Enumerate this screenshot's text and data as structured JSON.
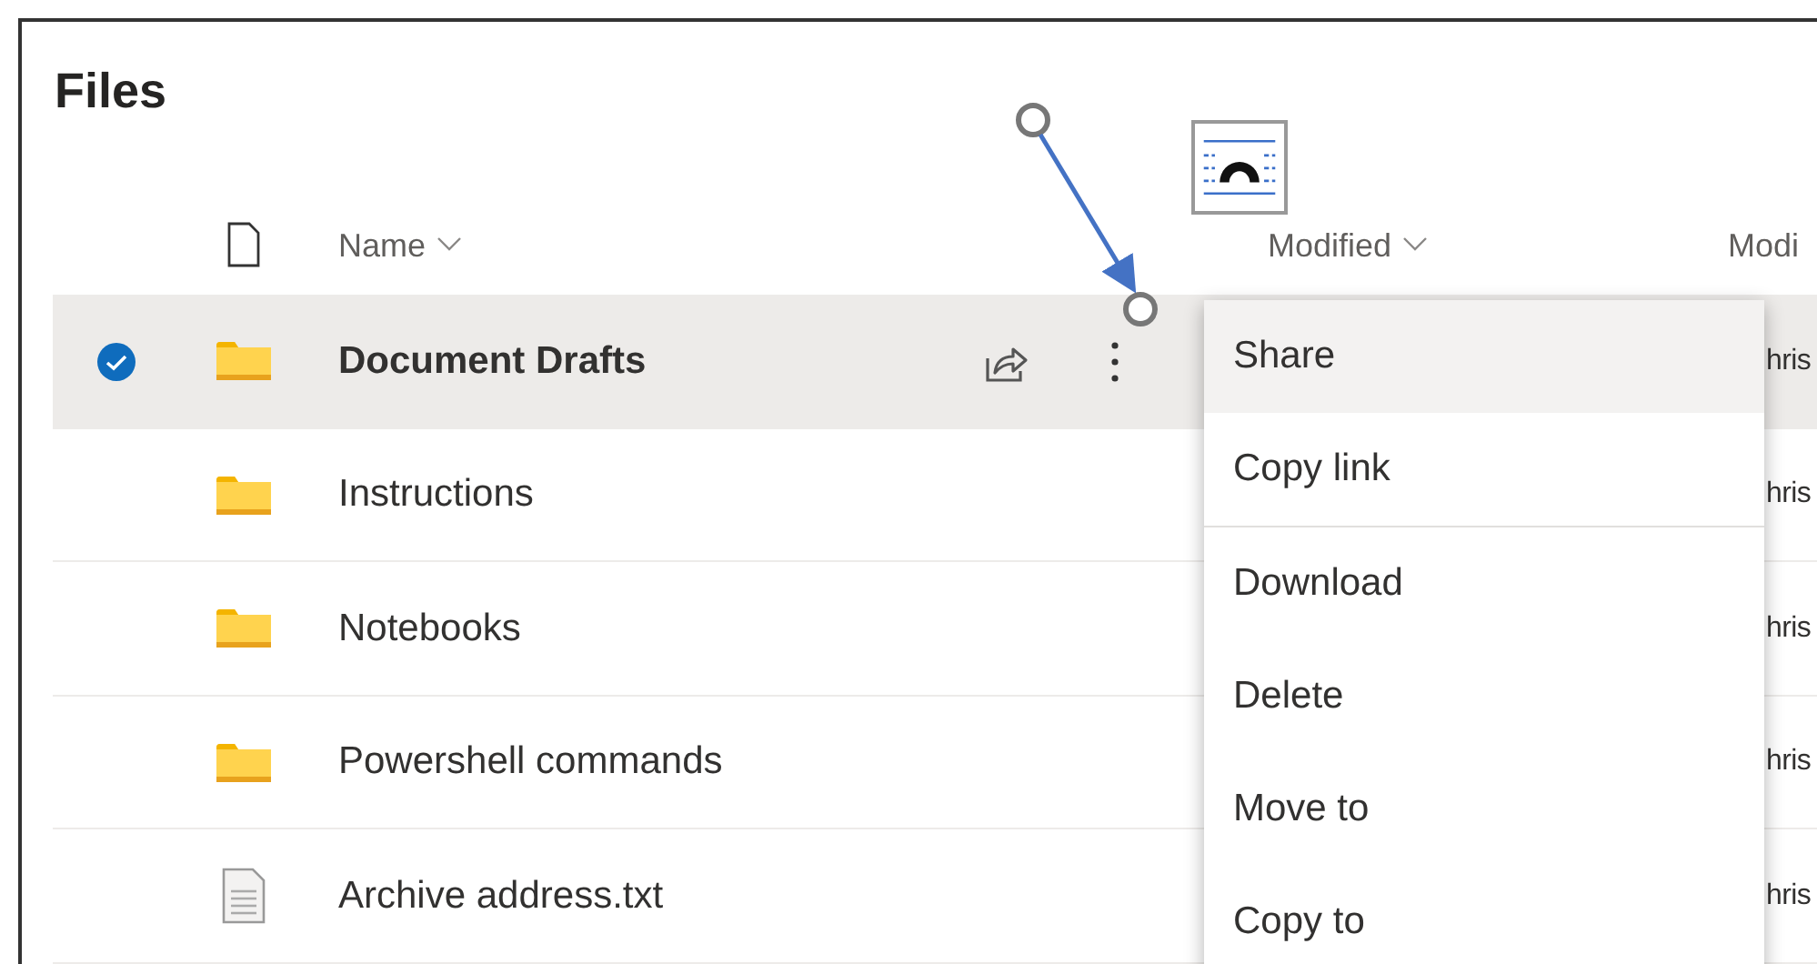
{
  "title": "Files",
  "columns": [
    {
      "label": "Name",
      "sortable": true
    },
    {
      "label": "Modified",
      "sortable": true
    },
    {
      "label": "Modi",
      "sortable": false
    }
  ],
  "rows": [
    {
      "name": "Document Drafts",
      "kind": "folder",
      "selected": true,
      "modified_by": "hris"
    },
    {
      "name": "Instructions",
      "kind": "folder",
      "selected": false,
      "modified_by": "hris"
    },
    {
      "name": "Notebooks",
      "kind": "folder",
      "selected": false,
      "modified_by": "hris"
    },
    {
      "name": "Powershell commands",
      "kind": "folder",
      "selected": false,
      "modified_by": "hris"
    },
    {
      "name": "Archive address.txt",
      "kind": "file",
      "selected": false,
      "modified_by": "hris"
    }
  ],
  "context_menu": [
    {
      "label": "Share",
      "highlighted": true,
      "separator_after": false
    },
    {
      "label": "Copy link",
      "highlighted": false,
      "separator_after": true
    },
    {
      "label": "Download",
      "highlighted": false,
      "separator_after": false
    },
    {
      "label": "Delete",
      "highlighted": false,
      "separator_after": false
    },
    {
      "label": "Move to",
      "highlighted": false,
      "separator_after": false
    },
    {
      "label": "Copy to",
      "highlighted": false,
      "separator_after": false
    }
  ]
}
